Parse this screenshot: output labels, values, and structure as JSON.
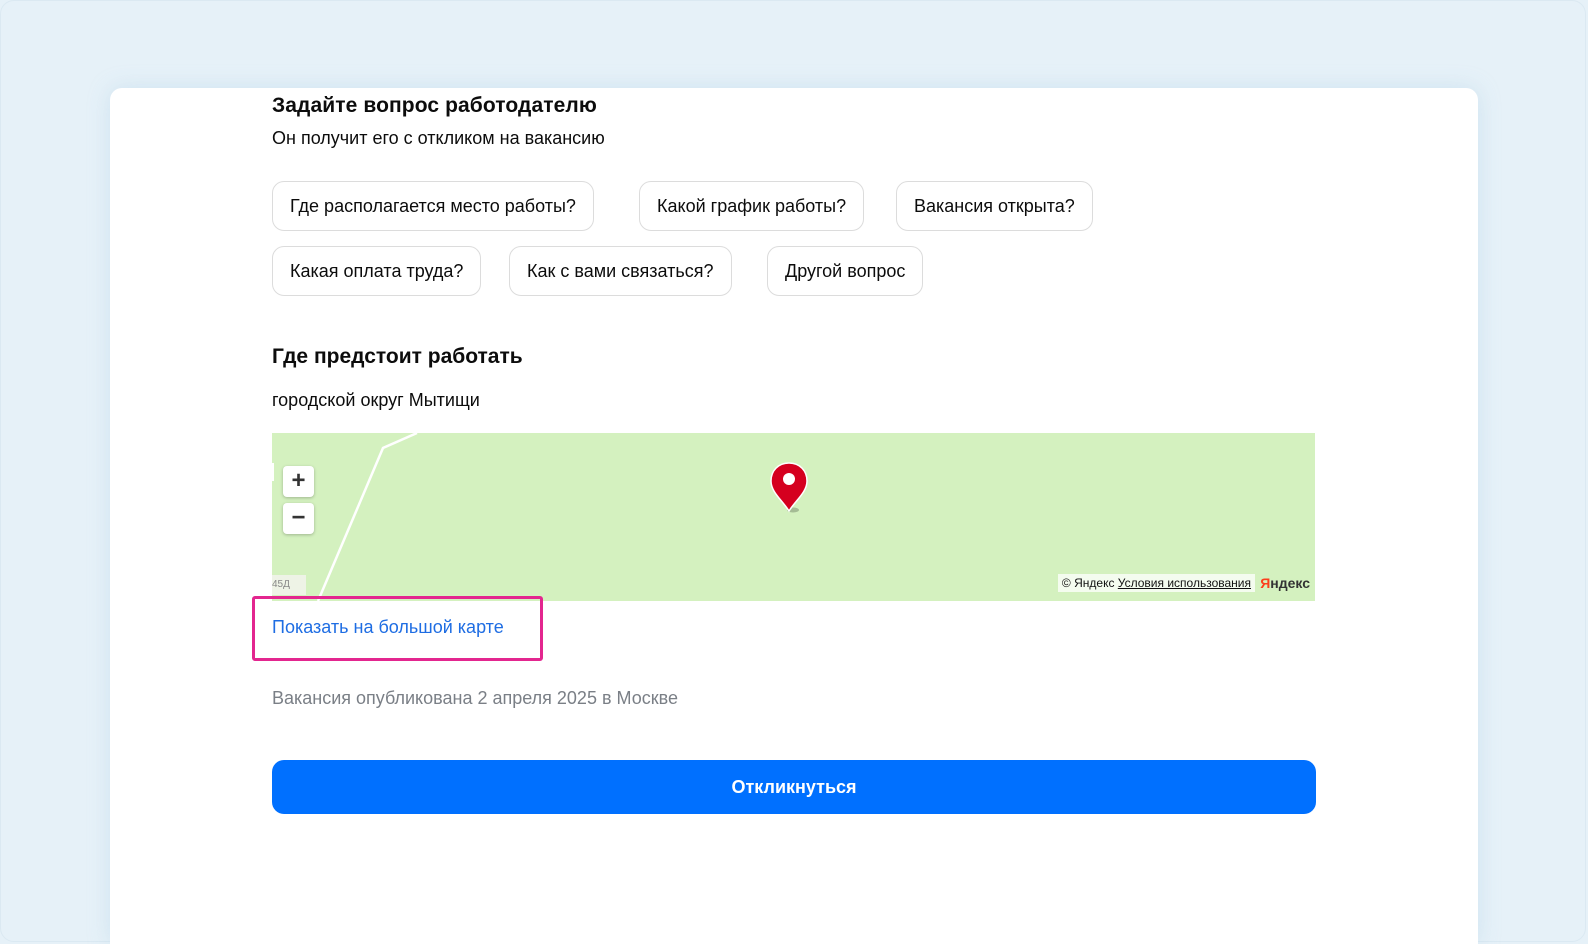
{
  "question_section": {
    "title": "Задайте вопрос работодателю",
    "subtitle": "Он получит его с откликом на вакансию",
    "chips": [
      "Где располагается место работы?",
      "Какой график работы?",
      "Вакансия открыта?",
      "Какая оплата труда?",
      "Как с вами связаться?",
      "Другой вопрос"
    ]
  },
  "location_section": {
    "title": "Где предстоит работать",
    "address": "городской округ Мытищи"
  },
  "map": {
    "zoom_in": "+",
    "zoom_out": "−",
    "road_label": "45Д",
    "copyright": "© Яндекс",
    "terms": "Условия использования",
    "logo_first": "Я",
    "logo_rest": "ндекс",
    "land_color": "#d4f1bf",
    "marker_color": "#d5001f",
    "marker_icon": "map-pin-icon"
  },
  "show_on_big_map": "Показать на большой карте",
  "published_text": "Вакансия опубликована 2 апреля 2025 в Москве",
  "respond_button": "Откликнуться",
  "colors": {
    "accent": "#0070ff",
    "link": "#1e6de3",
    "highlight": "#e3268f",
    "page_background": "#e6f1f8"
  }
}
